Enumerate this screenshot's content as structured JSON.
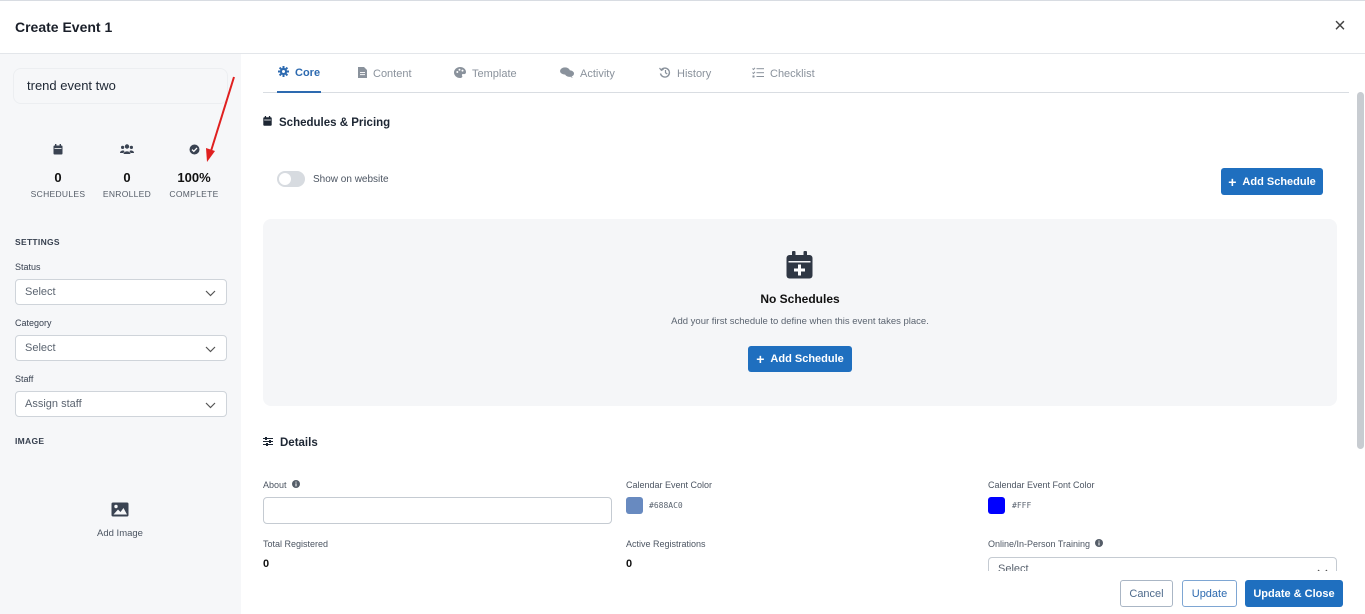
{
  "header": {
    "title": "Create Event 1",
    "close_icon": "close-icon"
  },
  "sidebar": {
    "event_name": "trend event two",
    "stats": [
      {
        "value": "0",
        "label": "SCHEDULES",
        "icon": "calendar-icon"
      },
      {
        "value": "0",
        "label": "ENROLLED",
        "icon": "users-icon"
      },
      {
        "value": "100%",
        "label": "COMPLETE",
        "icon": "check-circle-icon"
      }
    ],
    "settings_heading": "SETTINGS",
    "status": {
      "label": "Status",
      "value": "Select"
    },
    "category": {
      "label": "Category",
      "value": "Select"
    },
    "staff": {
      "label": "Staff",
      "value": "Assign staff"
    },
    "image_heading": "IMAGE",
    "add_image_label": "Add Image"
  },
  "tabs": [
    {
      "label": "Core",
      "icon": "gear-icon",
      "active": true
    },
    {
      "label": "Content",
      "icon": "document-icon",
      "active": false
    },
    {
      "label": "Template",
      "icon": "palette-icon",
      "active": false
    },
    {
      "label": "Activity",
      "icon": "comments-icon",
      "active": false
    },
    {
      "label": "History",
      "icon": "history-icon",
      "active": false
    },
    {
      "label": "Checklist",
      "icon": "checklist-icon",
      "active": false
    }
  ],
  "schedules": {
    "title": "Schedules & Pricing",
    "show_on_website_label": "Show on website",
    "show_on_website": false,
    "add_schedule_label": "Add Schedule",
    "empty_title": "No Schedules",
    "empty_text": "Add your first schedule to define when this event takes place.",
    "empty_button_label": "Add Schedule"
  },
  "details": {
    "title": "Details",
    "about_label": "About",
    "about_value": "",
    "calendar_color_label": "Calendar Event Color",
    "calendar_color_value": "#688AC0",
    "calendar_font_color_label": "Calendar Event Font Color",
    "calendar_font_color_value": "#FFF",
    "total_registered_label": "Total Registered",
    "total_registered_value": "0",
    "active_registrations_label": "Active Registrations",
    "active_registrations_value": "0",
    "training_label": "Online/In-Person Training",
    "training_value": "Select"
  },
  "footer": {
    "cancel_label": "Cancel",
    "update_label": "Update",
    "update_close_label": "Update & Close"
  },
  "colors": {
    "primary": "#1f6fbf",
    "active_tab": "#2d6ab0",
    "calendar_swatch": "#688AC0",
    "font_swatch": "#0000FF",
    "annotation_arrow": "#e02020"
  }
}
